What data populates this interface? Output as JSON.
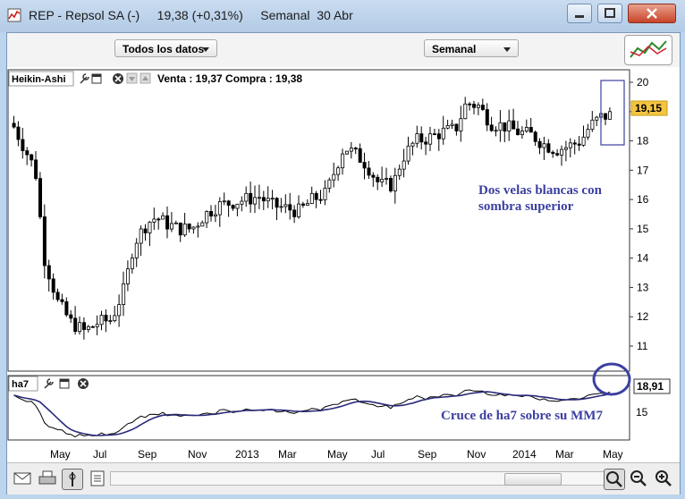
{
  "window": {
    "title": "REP - Repsol SA (-)     19,38 (+0,31%)     Semanal  30 Abr"
  },
  "toolbar": {
    "range_dropdown": "Todos los datos",
    "period_dropdown": "Semanal"
  },
  "main_panel": {
    "indicator_label": "Heikin-Ashi",
    "quote_text": "Venta : 19,37 Compra : 19,38",
    "price_tag": "19,15",
    "annotation_line1": "Dos velas blancas con",
    "annotation_line2": "sombra superior",
    "y_ticks": [
      "20",
      "19",
      "18",
      "17",
      "16",
      "15",
      "14",
      "13",
      "12",
      "11"
    ]
  },
  "sub_panel": {
    "indicator_label": "ha7",
    "price_tag": "18,91",
    "annotation": "Cruce de ha7 sobre su MM7",
    "y_ticks": [
      "15"
    ]
  },
  "x_axis": {
    "labels": [
      "May",
      "Jul",
      "Sep",
      "Nov",
      "2013",
      "Mar",
      "May",
      "Jul",
      "Sep",
      "Nov",
      "2014",
      "Mar",
      "May"
    ]
  },
  "colors": {
    "annotation": "#3b3fa0",
    "price_tag_bg": "#f5c542",
    "ma_line": "#2a2a7a"
  },
  "icons": [
    "wrench-icon",
    "window-icon",
    "close-icon",
    "arrow-down-icon",
    "arrow-up-icon",
    "mail-icon",
    "print-icon",
    "draw-tool-icon",
    "page-icon",
    "zoom-fit-icon",
    "zoom-out-icon",
    "zoom-in-icon"
  ]
}
